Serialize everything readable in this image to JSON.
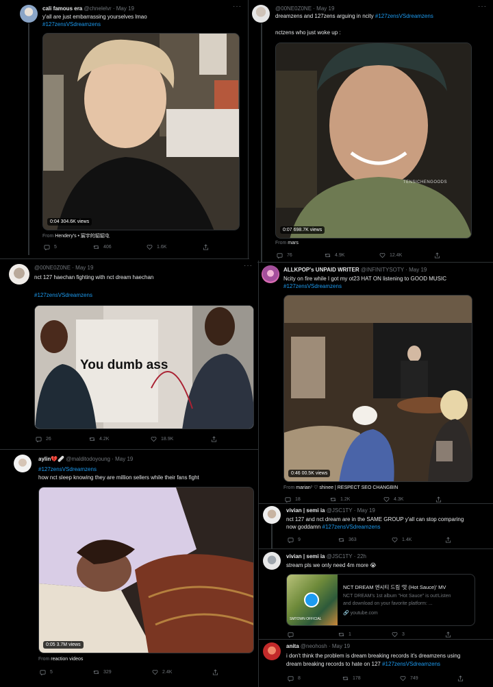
{
  "tweets": [
    {
      "name": "cali famous era",
      "handle": "@chnelelvr",
      "date": "· May 19",
      "text": "y'all are just embarrassing yourselves lmao",
      "hashtag": "#127zensVSdreamzens",
      "video_time": "0:04",
      "video_views": "304.6K views",
      "from_prefix": "From",
      "from_source": "Hendery's • 宸宇的貂貂屯",
      "stats": {
        "replies": "5",
        "retweets": "406",
        "likes": "1.6K"
      }
    },
    {
      "name": "",
      "handle": "@00NE0Z0NE",
      "date": "· May 19",
      "text": "dreamzens and 127zens arguing in ncity",
      "hashtag": "#127zensVSdreamzens",
      "text2": "nctzens who just woke up :",
      "video_time": "0:07",
      "video_views": "698.7K views",
      "watermark": "TENSICHENGOODS",
      "from_prefix": "From",
      "from_source": "mars",
      "stats": {
        "replies": "76",
        "retweets": "4.9K",
        "likes": "12.4K"
      }
    },
    {
      "name": "",
      "handle": "@00NE0Z0NE",
      "date": "· May 19",
      "text": "nct 127 haechan fighting with nct dream haechan",
      "hashtag": "#127zensVSdreamzens",
      "caption": "You dumb ass",
      "stats": {
        "replies": "26",
        "retweets": "4.2K",
        "likes": "18.9K"
      }
    },
    {
      "name": "ALLKPOP's UNPAID WRITER",
      "handle": "@INFINITYSOTY",
      "date": "· May 19",
      "text": "Ncity on fire while I got my ot23 HAT ON listening to GOOD MUSIC",
      "hashtag": "#127zensVSdreamzens",
      "video_time": "0:46",
      "video_views": "00.5K views",
      "from_prefix": "From",
      "from_source": "marian⁷ ♡ shinee | RESPECT SEO CHANGBIN",
      "stats": {
        "replies": "18",
        "retweets": "1.2K",
        "likes": "4.3K"
      }
    },
    {
      "name": "aylin💔🩹",
      "handle": "@malditodoyoung",
      "date": "· May 19",
      "hashtag": "#127zensVSdreamzens",
      "text": "how nct sleep knowing they are million sellers while their fans fight",
      "video_time": "0:05",
      "video_views": "3.7M views",
      "from_prefix": "From",
      "from_source": "reaction videos",
      "stats": {
        "replies": "5",
        "retweets": "329",
        "likes": "2.4K"
      }
    },
    {
      "name": "vivian | semi ia",
      "handle": "@JSC1TY",
      "date": "· May 19",
      "text": "nct 127 and nct dream are in the SAME GROUP y'all can stop comparing",
      "text2": "now goddamn",
      "hashtag": "#127zensVSdreamzens",
      "stats": {
        "replies": "9",
        "retweets": "363",
        "likes": "1.4K"
      }
    },
    {
      "name": "vivian | semi ia",
      "handle": "@JSC1TY",
      "date": "· 22h",
      "text": "stream pls we only need 4m more 😭",
      "card": {
        "title": "NCT DREAM 엔시티 드림 '맛 (Hot Sauce)' MV",
        "desc1": "NCT DREAM's 1st album \"Hot Sauce\" is out!Listen",
        "desc2": "and download on your favorite platform: ...",
        "link": "youtube.com",
        "thumb_label": "SMTOWN OFFICIAL"
      },
      "stats": {
        "replies": "",
        "retweets": "1",
        "likes": "3"
      }
    },
    {
      "name": "anita",
      "handle": "@neohosh",
      "date": "· May 19",
      "text": "i don't think the problem is dream breaking records it's dreamzens using",
      "text2": "dream breaking records to hate on 127",
      "hashtag": "#127zensVSdreamzens",
      "stats": {
        "replies": "8",
        "retweets": "178",
        "likes": "749"
      }
    }
  ],
  "icons": {
    "reply": "reply-icon",
    "retweet": "retweet-icon",
    "like": "heart-icon",
    "share": "share-icon",
    "more": "more-icon"
  },
  "more_glyph": "···",
  "colors": {
    "accent": "#1d9bf0",
    "background": "#000000",
    "muted": "#71767b"
  }
}
